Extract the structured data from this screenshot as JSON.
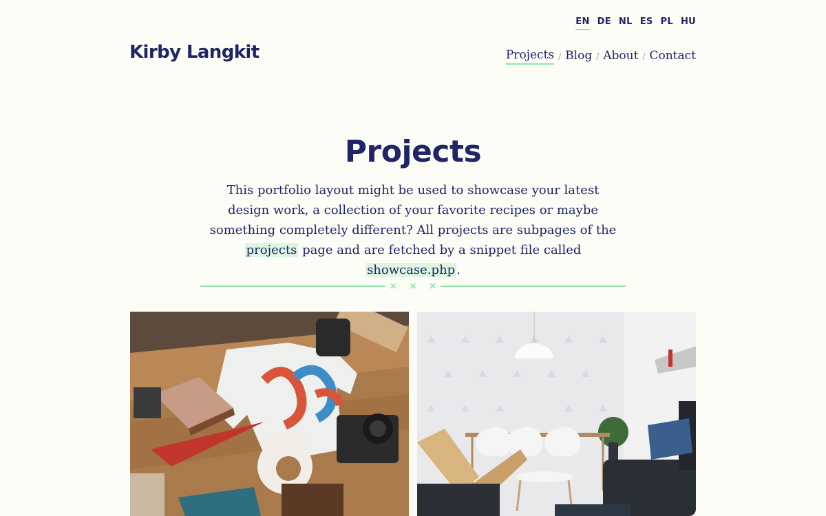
{
  "languages": [
    {
      "code": "EN",
      "active": true
    },
    {
      "code": "DE"
    },
    {
      "code": "NL"
    },
    {
      "code": "ES"
    },
    {
      "code": "PL"
    },
    {
      "code": "HU"
    }
  ],
  "site": {
    "title": "Kirby Langkit"
  },
  "nav": {
    "items": [
      {
        "label": "Projects",
        "active": true
      },
      {
        "label": "Blog"
      },
      {
        "label": "About"
      },
      {
        "label": "Contact"
      }
    ],
    "separator": "/"
  },
  "page": {
    "title": "Projects",
    "intro": {
      "text_1": "This portfolio layout might be used to showcase your latest design work, a collection of your favorite recipes or maybe something completely different? All projects are subpages of the ",
      "link_1": "projects",
      "text_2": " page and are fetched by a snippet file called ",
      "link_2": "showcase.php",
      "text_3": "."
    },
    "divider_marks": "× × ×"
  },
  "colors": {
    "background": "#fdfdf8",
    "text": "#1f2566",
    "accent": "#8ce7a9"
  },
  "showcase": [
    {
      "image": "flat-lay-design-tools-photo"
    },
    {
      "image": "dining-room-interior-photo"
    }
  ]
}
